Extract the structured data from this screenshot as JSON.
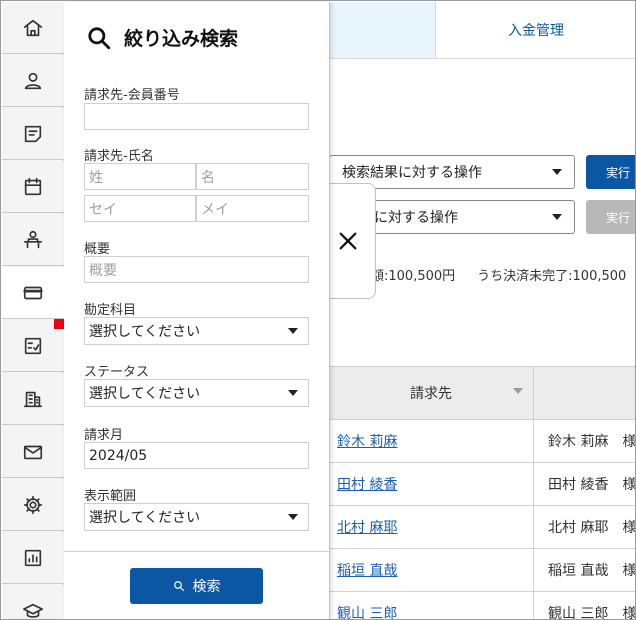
{
  "rail": {
    "items": [
      {
        "icon": "home-icon"
      },
      {
        "icon": "user-icon"
      },
      {
        "icon": "notes-icon"
      },
      {
        "icon": "calendar-icon"
      },
      {
        "icon": "reception-icon"
      },
      {
        "icon": "credit-card-icon",
        "active": true
      },
      {
        "icon": "checklist-icon"
      },
      {
        "icon": "building-icon"
      },
      {
        "icon": "mail-icon"
      },
      {
        "icon": "gear-icon"
      },
      {
        "icon": "report-chart-icon"
      },
      {
        "icon": "graduation-cap-icon"
      }
    ],
    "badge_color": "#e60012"
  },
  "header": {
    "tab_payment_management": "入金管理"
  },
  "operations": {
    "bulk_select_label": "検索結果に対する操作",
    "selected_select_label": "に対する操作",
    "run_label": "実行",
    "run_label_disabled": "実行"
  },
  "summary": {
    "total_text": "額:100,500円",
    "unsettled_text": "うち決済未完了:100,500"
  },
  "table": {
    "header_billing": "請求先",
    "rows": [
      {
        "name": "鈴木 莉麻",
        "kana": "鈴木 莉麻　様"
      },
      {
        "name": "田村 綾香",
        "kana": "田村 綾香　様"
      },
      {
        "name": "北村 麻耶",
        "kana": "北村 麻耶　様"
      },
      {
        "name": "稲垣 直哉",
        "kana": "稲垣 直哉　様"
      },
      {
        "name": "観山 三郎",
        "kana": "観山 三郎　様"
      }
    ]
  },
  "filter": {
    "title": "絞り込み検索",
    "member_no_label": "請求先-会員番号",
    "member_no_value": "",
    "name_label": "請求先-氏名",
    "last_name_placeholder": "姓",
    "first_name_placeholder": "名",
    "last_kana_placeholder": "セイ",
    "first_kana_placeholder": "メイ",
    "summary_label": "概要",
    "summary_placeholder": "概要",
    "account_label": "勘定科目",
    "account_value": "選択してください",
    "status_label": "ステータス",
    "status_value": "選択してください",
    "month_label": "請求月",
    "month_value": "2024/05",
    "range_label": "表示範囲",
    "range_value": "選択してください",
    "search_button": "検索"
  },
  "colors": {
    "primary": "#0b57a3",
    "link": "#1a5fb4",
    "disabled": "#b8b8b8",
    "active_tab_bg": "#e9f5fc"
  }
}
